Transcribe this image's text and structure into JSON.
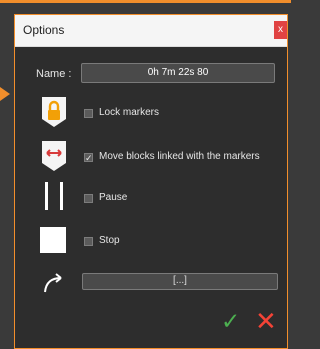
{
  "dialog": {
    "title": "Options",
    "close_label": "x",
    "name_label": "Name :",
    "name_value": "0h 7m 22s 80",
    "rows": [
      {
        "label": "Lock markers",
        "checked": false,
        "icon": "lock-icon"
      },
      {
        "label": "Move blocks linked with the markers",
        "checked": true,
        "icon": "link-arrows-icon"
      },
      {
        "label": "Pause",
        "checked": false,
        "icon": "pause-icon"
      },
      {
        "label": "Stop",
        "checked": false,
        "icon": "stop-icon"
      }
    ],
    "action_value": "[...]",
    "action_icon": "redirect-arrow-icon",
    "ok_label": "✓",
    "cancel_label": "✕",
    "colors": {
      "accent": "#f28e2b",
      "background": "#2d2d2d",
      "ok": "#4caf50",
      "cancel": "#f44336"
    }
  }
}
